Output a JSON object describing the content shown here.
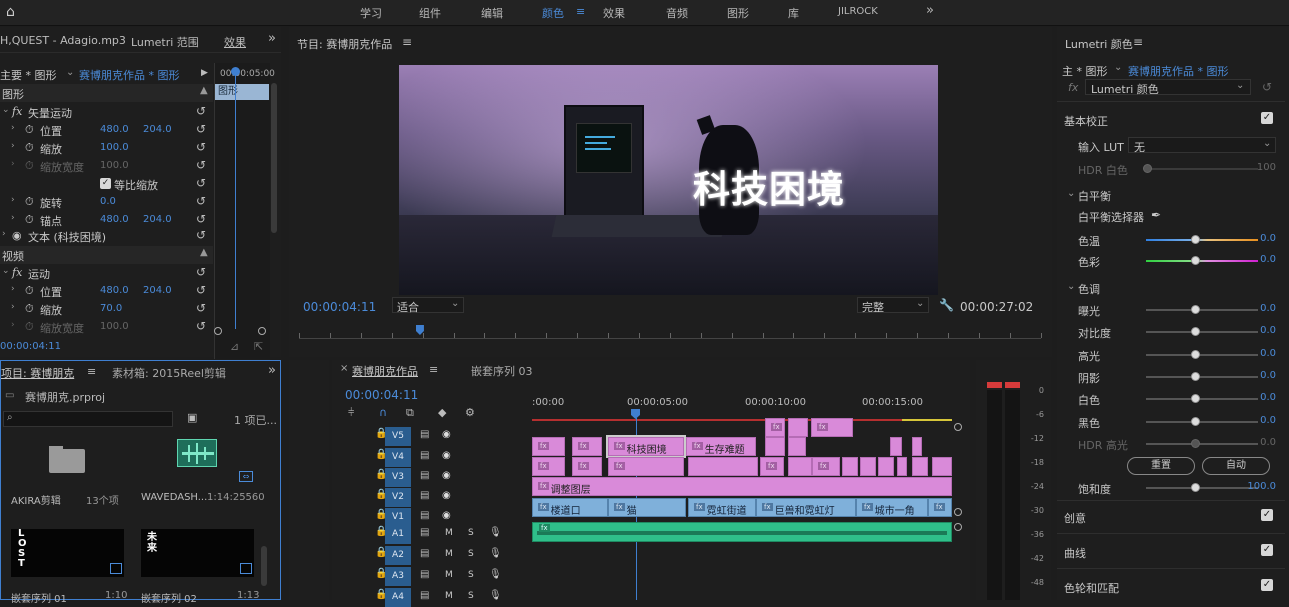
{
  "topbar": {
    "home_icon": "home-icon",
    "workspaces": [
      "学习",
      "组件",
      "编辑",
      "颜色",
      "效果",
      "音频",
      "图形",
      "库",
      "JILROCK"
    ],
    "active_workspace": "颜色",
    "overflow": "»"
  },
  "effect_controls": {
    "tab_source": "H,QUEST - Adagio.mp3",
    "tab_lumetri_scope": "Lumetri 范围",
    "tab_effects": "效果",
    "master_label": "主要 * 图形",
    "clip_label": "赛博朋克作品 * 图形",
    "mini_timecode": "00:00:05:00",
    "mini_clip": "图形",
    "section_graphic": "图形",
    "vector_motion": "矢量运动",
    "rows": [
      {
        "label": "位置",
        "v1": "480.0",
        "v2": "204.0"
      },
      {
        "label": "缩放",
        "v1": "100.0",
        "v2": ""
      },
      {
        "label": "缩放宽度",
        "v1": "100.0",
        "v2": "",
        "dim": true
      },
      {
        "label": "等比缩放",
        "v1": "",
        "v2": ""
      },
      {
        "label": "旋转",
        "v1": "0.0",
        "v2": ""
      },
      {
        "label": "锚点",
        "v1": "480.0",
        "v2": "204.0"
      }
    ],
    "text_layer": "文本 (科技困境)",
    "section_video": "视频",
    "motion": "运动",
    "rows2": [
      {
        "label": "位置",
        "v1": "480.0",
        "v2": "204.0"
      },
      {
        "label": "缩放",
        "v1": "70.0",
        "v2": ""
      },
      {
        "label": "缩放宽度",
        "v1": "100.0",
        "v2": "",
        "dim": true
      }
    ],
    "timecode": "00:00:04:11"
  },
  "program": {
    "title": "节目: 赛博朋克作品",
    "menu": "≡",
    "overlay_text": "科技困境",
    "timecode": "00:00:04:11",
    "fit": "适合",
    "quality": "完整",
    "duration": "00:00:27:02",
    "playhead_fraction": 0.163
  },
  "project": {
    "tab_project": "项目: 赛博朋克",
    "tab_bin": "素材箱: 2015Reel剪辑",
    "file": "赛博朋克.prproj",
    "item_count": "1 项已...",
    "items": [
      {
        "name": "AKIRA剪辑",
        "meta": "13个项"
      },
      {
        "name": "WAVEDASH...",
        "meta": "1:14:25560"
      },
      {
        "name": "嵌套序列 01",
        "meta": "1:10"
      },
      {
        "name": "嵌套序列 02",
        "meta": "1:13"
      }
    ],
    "thumb_lost": "LOST",
    "thumb_2": "未来"
  },
  "timeline": {
    "tab_active": "赛博朋克作品",
    "tab_other": "嵌套序列 03",
    "timecode": "00:00:04:11",
    "ruler": [
      ":00:00",
      "00:00:05:00",
      "00:00:10:00",
      "00:00:15:00"
    ],
    "video_tracks": [
      "V5",
      "V4",
      "V3",
      "V2",
      "V1"
    ],
    "audio_tracks": [
      "A1",
      "A2",
      "A3",
      "A4"
    ],
    "v4_clip1": "科技困境",
    "v4_clip2": "生存难题",
    "v2_clip": "调整图层",
    "v1_clips": [
      "楼道口",
      "猫",
      "霓虹街道",
      "巨兽和霓虹灯",
      "城市一角"
    ],
    "fx_badge": "fx",
    "mute": "M",
    "solo": "S"
  },
  "meter": {
    "labels": [
      "0",
      "-6",
      "-12",
      "-18",
      "-24",
      "-30",
      "-36",
      "-42",
      "-48"
    ]
  },
  "lumetri": {
    "title": "Lumetri 颜色",
    "menu": "≡",
    "master": "主 * 图形",
    "clip": "赛博朋克作品 * 图形",
    "preset": "Lumetri 颜色",
    "basic": "基本校正",
    "input_lut": "输入 LUT",
    "lut_value": "无",
    "hdr_white": "HDR 白色",
    "hdr_white_val": "100",
    "wb": "白平衡",
    "wb_selector": "白平衡选择器",
    "temp": "色温",
    "temp_val": "0.0",
    "tint": "色彩",
    "tint_val": "0.0",
    "tone": "色调",
    "tone_rows": [
      {
        "label": "曝光",
        "val": "0.0",
        "dim": false
      },
      {
        "label": "对比度",
        "val": "0.0",
        "dim": false
      },
      {
        "label": "高光",
        "val": "0.0",
        "dim": false
      },
      {
        "label": "阴影",
        "val": "0.0",
        "dim": false
      },
      {
        "label": "白色",
        "val": "0.0",
        "dim": false
      },
      {
        "label": "黑色",
        "val": "0.0",
        "dim": false
      },
      {
        "label": "HDR 高光",
        "val": "0.0",
        "dim": true
      }
    ],
    "reset": "重置",
    "auto": "自动",
    "saturation": "饱和度",
    "saturation_val": "100.0",
    "sections": [
      "创意",
      "曲线",
      "色轮和匹配"
    ],
    "accent": "#4b8bd9"
  }
}
